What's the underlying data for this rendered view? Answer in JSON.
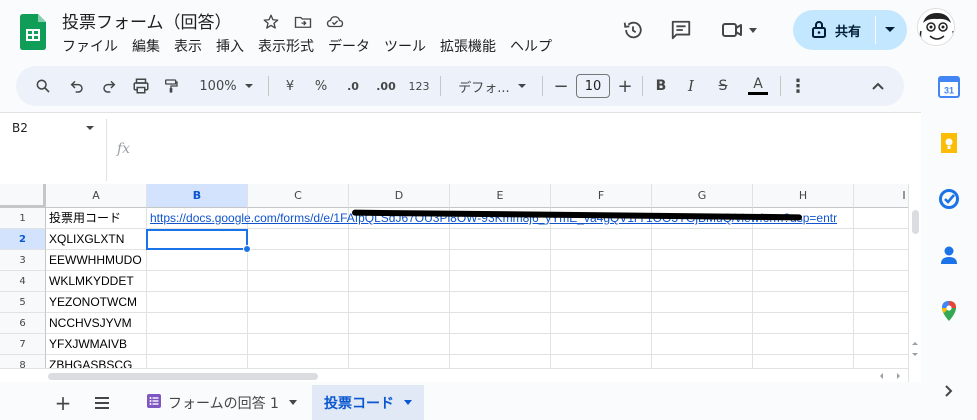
{
  "doc": {
    "title": "投票フォーム（回答）"
  },
  "menu": [
    "ファイル",
    "編集",
    "表示",
    "挿入",
    "表示形式",
    "データ",
    "ツール",
    "拡張機能",
    "ヘルプ"
  ],
  "share": {
    "label": "共有"
  },
  "toolbar": {
    "zoom": "100%",
    "currency": "¥",
    "percent": "%",
    "dec_decrease": ".0",
    "dec_increase": ".00",
    "number_format": "123",
    "font": "デフォ...",
    "font_size": "10"
  },
  "formula": {
    "namebox": "B2",
    "fx": "fx"
  },
  "grid": {
    "columns": [
      "A",
      "B",
      "C",
      "D",
      "E",
      "F",
      "G",
      "H",
      "I"
    ],
    "rows": [
      "1",
      "2",
      "3",
      "4",
      "5",
      "6",
      "7",
      "8"
    ],
    "selected_column": "B",
    "selected_row": "2",
    "cells": {
      "A1": "投票用コード",
      "B1": "https://docs.google.com/forms/d/e/1FAIpQLSdJ67OU3Pl8OW-93Kmm8j6_yYmE_va4gQV1rY1OO3YGjBMuQ/viewform?usp=entr",
      "A2": "XQLIXGLXTN",
      "A3": "EEWWHHMUDO",
      "A4": "WKLMKYDDET",
      "A5": "YEZONOTWCM",
      "A6": "NCCHVSJYVM",
      "A7": "YFXJWMAIVB",
      "A8": "ZBHGASBSCG"
    }
  },
  "sheets": [
    {
      "label": "フォームの回答 1",
      "active": false
    },
    {
      "label": "投票コード",
      "active": true
    }
  ],
  "colors": {
    "accent": "#0b57d0",
    "share_bg": "#c2e7ff",
    "sheets_green": "#0f9d58"
  }
}
